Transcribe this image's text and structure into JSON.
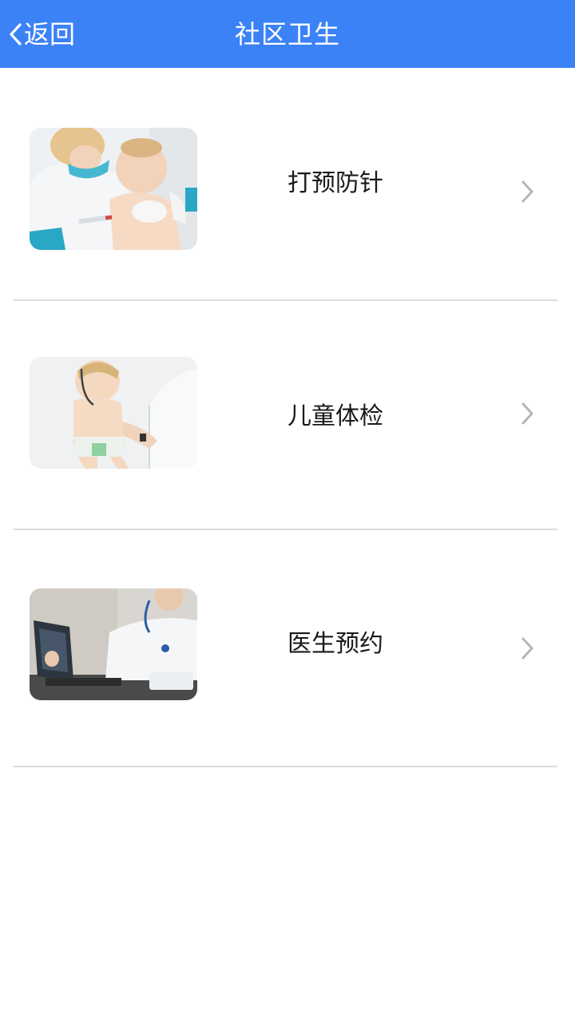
{
  "header": {
    "back_label": "返回",
    "title": "社区卫生",
    "background": "#3b82f6"
  },
  "list": {
    "items": [
      {
        "label": "打预防针",
        "image": "nurse-vaccinating-baby-photo",
        "chevron": "chevron-right-icon"
      },
      {
        "label": "儿童体检",
        "image": "doctor-stethoscope-child-photo",
        "chevron": "chevron-right-icon"
      },
      {
        "label": "医生预约",
        "image": "doctor-on-phone-xray-photo",
        "chevron": "chevron-right-icon"
      }
    ]
  }
}
